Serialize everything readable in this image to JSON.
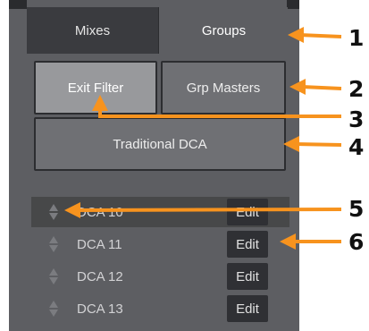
{
  "tabs": {
    "mixes_label": "Mixes",
    "groups_label": "Groups"
  },
  "buttons": {
    "exit_filter_label": "Exit Filter",
    "grp_masters_label": "Grp Masters",
    "traditional_dca_label": "Traditional DCA"
  },
  "dca_list": {
    "items": [
      {
        "label": "DCA 10",
        "edit_label": "Edit",
        "selected": true
      },
      {
        "label": "DCA 11",
        "edit_label": "Edit",
        "selected": false
      },
      {
        "label": "DCA 12",
        "edit_label": "Edit",
        "selected": false
      },
      {
        "label": "DCA 13",
        "edit_label": "Edit",
        "selected": false
      }
    ]
  },
  "callouts": [
    "1",
    "2",
    "3",
    "4",
    "5",
    "6"
  ],
  "colors": {
    "panel_bg": "#5d5e62",
    "tab_inactive_bg": "#3a3b3f",
    "button_bg": "#6f7074",
    "button_active_bg": "#98999c",
    "edit_bg": "#2f3034",
    "annotation_arrow": "#f7931e"
  },
  "icons": {
    "row_handle": "sort-updown-icon",
    "annotation": "arrow-left-icon"
  }
}
